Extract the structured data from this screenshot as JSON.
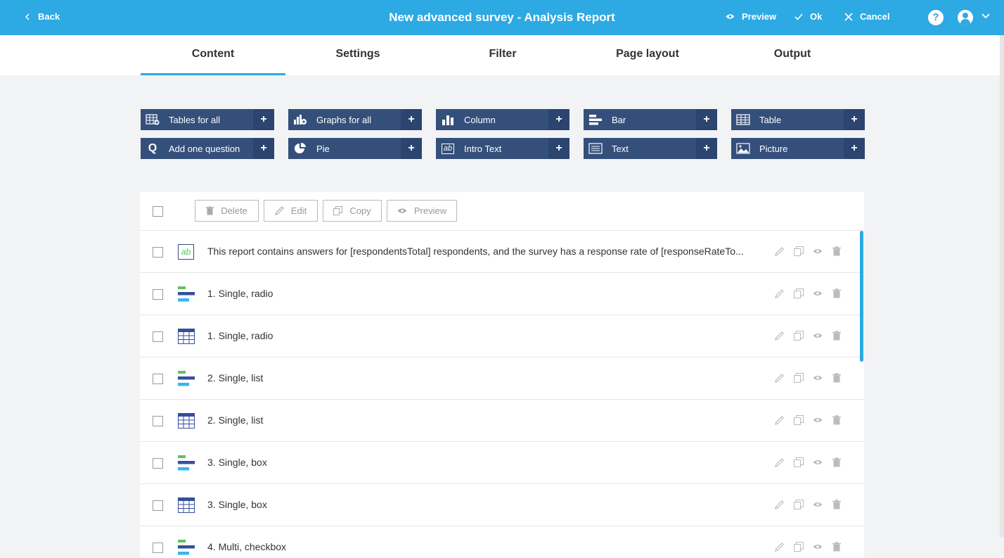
{
  "topbar": {
    "back_label": "Back",
    "title": "New advanced survey - Analysis Report",
    "preview_label": "Preview",
    "ok_label": "Ok",
    "cancel_label": "Cancel",
    "help_label": "?",
    "background": "#2da9e3"
  },
  "tabs": [
    {
      "label": "Content",
      "active": true
    },
    {
      "label": "Settings",
      "active": false
    },
    {
      "label": "Filter",
      "active": false
    },
    {
      "label": "Page layout",
      "active": false
    },
    {
      "label": "Output",
      "active": false
    }
  ],
  "add_buttons": [
    {
      "label": "Tables for all",
      "icon": "tables-for-all-icon"
    },
    {
      "label": "Graphs for all",
      "icon": "graphs-for-all-icon"
    },
    {
      "label": "Column",
      "icon": "column-chart-icon"
    },
    {
      "label": "Bar",
      "icon": "bar-chart-icon"
    },
    {
      "label": "Table",
      "icon": "table-icon"
    },
    {
      "label": "Add one question",
      "icon": "question-icon",
      "glyph": "Q"
    },
    {
      "label": "Pie",
      "icon": "pie-chart-icon"
    },
    {
      "label": "Intro Text",
      "icon": "intro-text-icon",
      "glyph": "ab"
    },
    {
      "label": "Text",
      "icon": "text-icon"
    },
    {
      "label": "Picture",
      "icon": "picture-icon"
    }
  ],
  "add_plus": "+",
  "toolbar": {
    "delete_label": "Delete",
    "edit_label": "Edit",
    "copy_label": "Copy",
    "preview_label": "Preview"
  },
  "rows": [
    {
      "type": "intro-text",
      "glyph": "ab",
      "text": "This report contains answers for [respondentsTotal] respondents, and the survey has a response rate of [responseRateTo..."
    },
    {
      "type": "bar",
      "text": "1. Single, radio"
    },
    {
      "type": "table",
      "text": "1. Single, radio"
    },
    {
      "type": "bar",
      "text": "2. Single, list"
    },
    {
      "type": "table",
      "text": "2. Single, list"
    },
    {
      "type": "bar",
      "text": "3. Single, box"
    },
    {
      "type": "table",
      "text": "3. Single, box"
    },
    {
      "type": "bar",
      "text": "4. Multi, checkbox"
    }
  ],
  "colors": {
    "accent": "#2da9e3",
    "add_button_bg": "#354f7b",
    "bar_green": "#5cc45c",
    "bar_blue": "#354f9c",
    "bar_light": "#3ab4f0"
  }
}
